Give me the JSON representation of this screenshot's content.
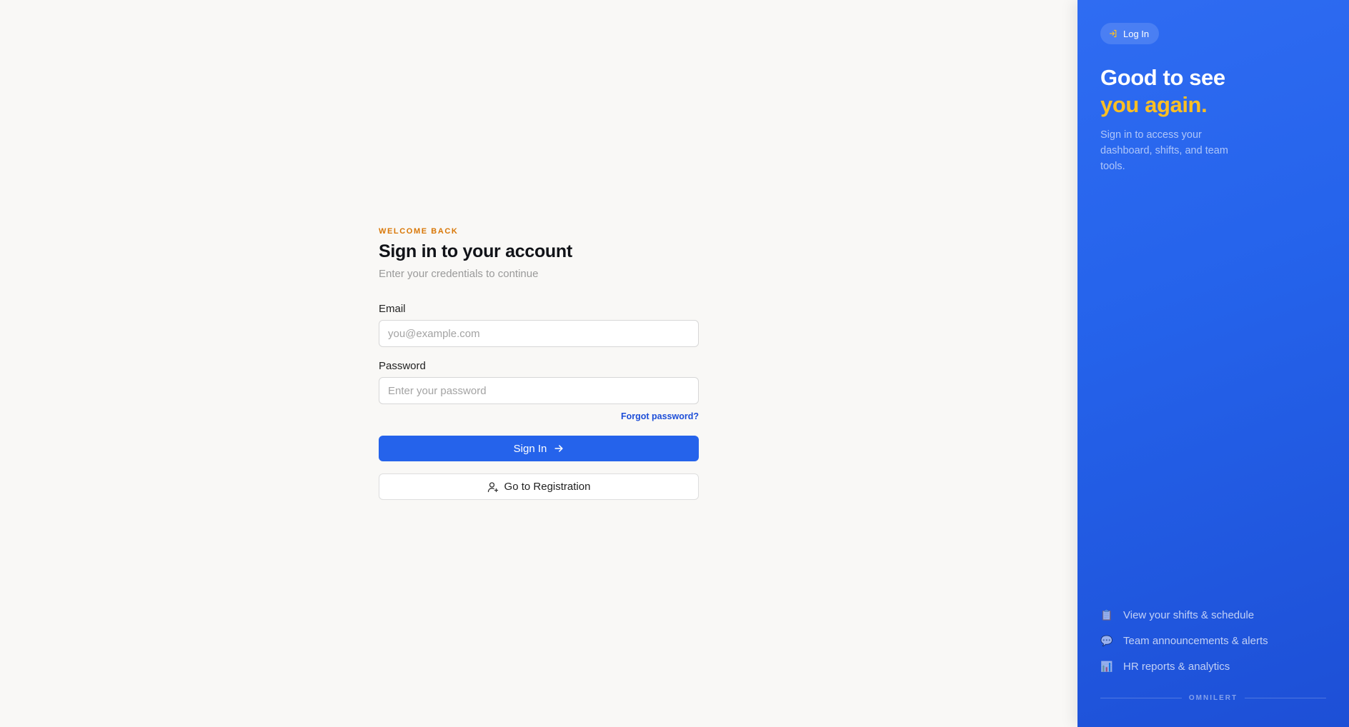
{
  "login": {
    "eyebrow": "WELCOME BACK",
    "title": "Sign in to your account",
    "subtitle": "Enter your credentials to continue",
    "email_label": "Email",
    "email_placeholder": "you@example.com",
    "email_value": "",
    "password_label": "Password",
    "password_placeholder": "Enter your password",
    "password_value": "",
    "forgot_link": "Forgot password?",
    "sign_in_button": "Sign In",
    "register_button": "Go to Registration"
  },
  "panel": {
    "badge": "Log In",
    "headline_line1": "Good to see",
    "headline_line2": "you again.",
    "lead": "Sign in to access your dashboard, shifts, and team tools.",
    "features": [
      {
        "icon": "clipboard-icon",
        "label": "View your shifts & schedule"
      },
      {
        "icon": "speech-bubble-icon",
        "label": "Team announcements & alerts"
      },
      {
        "icon": "bar-chart-icon",
        "label": "HR reports & analytics"
      }
    ],
    "brand": "OMNILERT"
  },
  "colors": {
    "accent": "#2563eb",
    "eyebrow": "#d97706",
    "highlight": "#fbbf24",
    "link": "#1d4ed8"
  }
}
